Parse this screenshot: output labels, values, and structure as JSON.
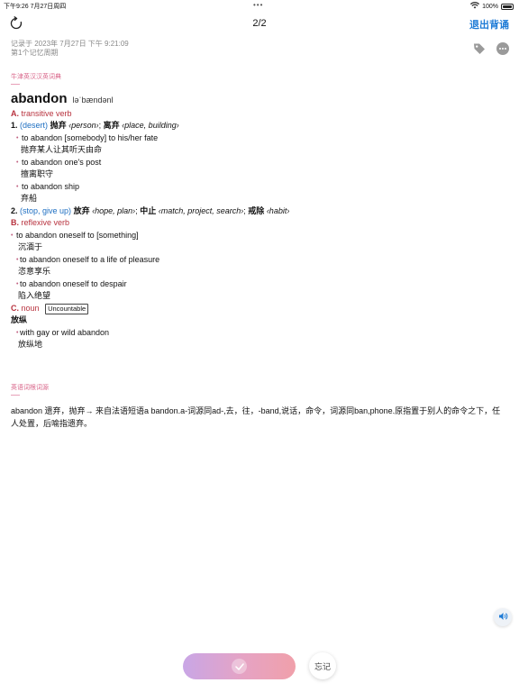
{
  "status_bar": {
    "time_date": "下午9:26   7月27日周四",
    "dots": "•••",
    "battery": "100%"
  },
  "nav": {
    "page_counter": "2/2",
    "exit_label": "退出背诵"
  },
  "meta": {
    "recorded": "记录于 2023年 7月27日 下午 9:21:09",
    "cycle": "第1个记忆周期"
  },
  "dictionary": {
    "source_label": "牛津英汉汉英词典",
    "headword": "abandon",
    "phonetic": "ləˈbændənl",
    "sections": {
      "a": {
        "letter": "A.",
        "pos": "transitive verb",
        "sense1": {
          "num": "1.",
          "gloss": "(desert)",
          "cn1": "抛弃",
          "obj1": "‹person›",
          "sep": ";",
          "cn2": "离弃",
          "obj2": "‹place, building›"
        },
        "examples1": [
          {
            "en": "to abandon [somebody] to his/her fate",
            "zh": "抛弃某人让其听天由命"
          },
          {
            "en": "to abandon one's post",
            "zh": "擅离职守"
          },
          {
            "en": "to abandon ship",
            "zh": "弃船"
          }
        ],
        "sense2": {
          "num": "2.",
          "gloss": "(stop, give up)",
          "cn1": "放弃",
          "obj1": "‹hope, plan›",
          "cn2": "中止",
          "obj2": "‹match, project, search›",
          "cn3": "戒除",
          "obj3": "‹habit›"
        }
      },
      "b": {
        "letter": "B.",
        "pos": "reflexive verb",
        "examples": [
          {
            "en": "to abandon oneself to [something]",
            "zh": "沉湎于"
          },
          {
            "en": "to abandon oneself to a life of pleasure",
            "zh": "恣意享乐"
          },
          {
            "en": "to abandon oneself to despair",
            "zh": "陷入绝望"
          }
        ]
      },
      "c": {
        "letter": "C.",
        "pos": "noun",
        "badge": "Uncountable",
        "cn": "放纵",
        "examples": [
          {
            "en": "with gay or wild abandon",
            "zh": "放纵地"
          }
        ]
      }
    }
  },
  "etymology": {
    "source_label": "英语词根词源",
    "text": "abandon 遗弃，抛弃→ 来自法语短语a bandon.a-词源同ad-,去，往，-band,说话，命令，词源同ban,phone.原指置于别人的命令之下，任人处置，后喻指遗弃。"
  },
  "actions": {
    "forget_label": "忘记"
  },
  "colors": {
    "accent_blue": "#1e7bd6",
    "pos_red": "#b8333f",
    "section_pink": "#d9668a"
  }
}
